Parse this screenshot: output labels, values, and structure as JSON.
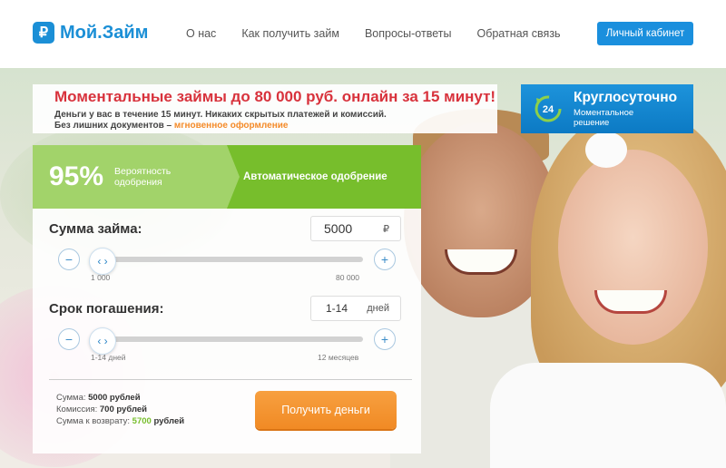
{
  "header": {
    "logo_text": "Мой.Займ",
    "logo_symbol": "₽",
    "nav": [
      {
        "label": "О нас"
      },
      {
        "label": "Как получить займ"
      },
      {
        "label": "Вопросы-ответы"
      },
      {
        "label": "Обратная связь"
      }
    ],
    "cabinet_label": "Личный кабинет"
  },
  "promo": {
    "title": "Моментальные займы до 80 000 руб. онлайн за 15 минут!",
    "line1": "Деньги у вас в течение 15 минут. Никаких скрытых платежей и комиссий.",
    "line2_prefix": "Без лишних документов – ",
    "line2_accent": "мгновенное оформление"
  },
  "badge24": {
    "icon_number": "24",
    "title": "Круглосуточно",
    "subtitle": "Моментальное решение"
  },
  "approval": {
    "percent": "95%",
    "percent_label": "Вероятность одобрения",
    "auto_label": "Автоматическое одобрение"
  },
  "amount": {
    "label": "Сумма займа:",
    "value": "5000",
    "unit": "₽",
    "min_label": "1 000",
    "max_label": "80 000",
    "level": 0.0,
    "minus": "−",
    "plus": "+"
  },
  "term": {
    "label": "Срок погашения:",
    "value": "1-14",
    "unit": "дней",
    "min_label": "1-14 дней",
    "max_label": "12 месяцев",
    "level": 0.0,
    "minus": "−",
    "plus": "+"
  },
  "summary": {
    "sum_label": "Сумма:",
    "sum_value": "5000 рублей",
    "fee_label": "Комиссия:",
    "fee_value": "700 рублей",
    "return_label": "Сумма к возврату:",
    "return_value": "5700",
    "return_unit": "рублей"
  },
  "cta_label": "Получить деньги",
  "colors": {
    "brand_blue": "#1b8fd6",
    "promo_red": "#d8323c",
    "accent_orange": "#f48b29",
    "approval_light": "#a2d36a",
    "approval_dark": "#77be2c"
  },
  "icons": {
    "knob": "chevron-left-right-icon",
    "clock": "clock-24-icon"
  }
}
